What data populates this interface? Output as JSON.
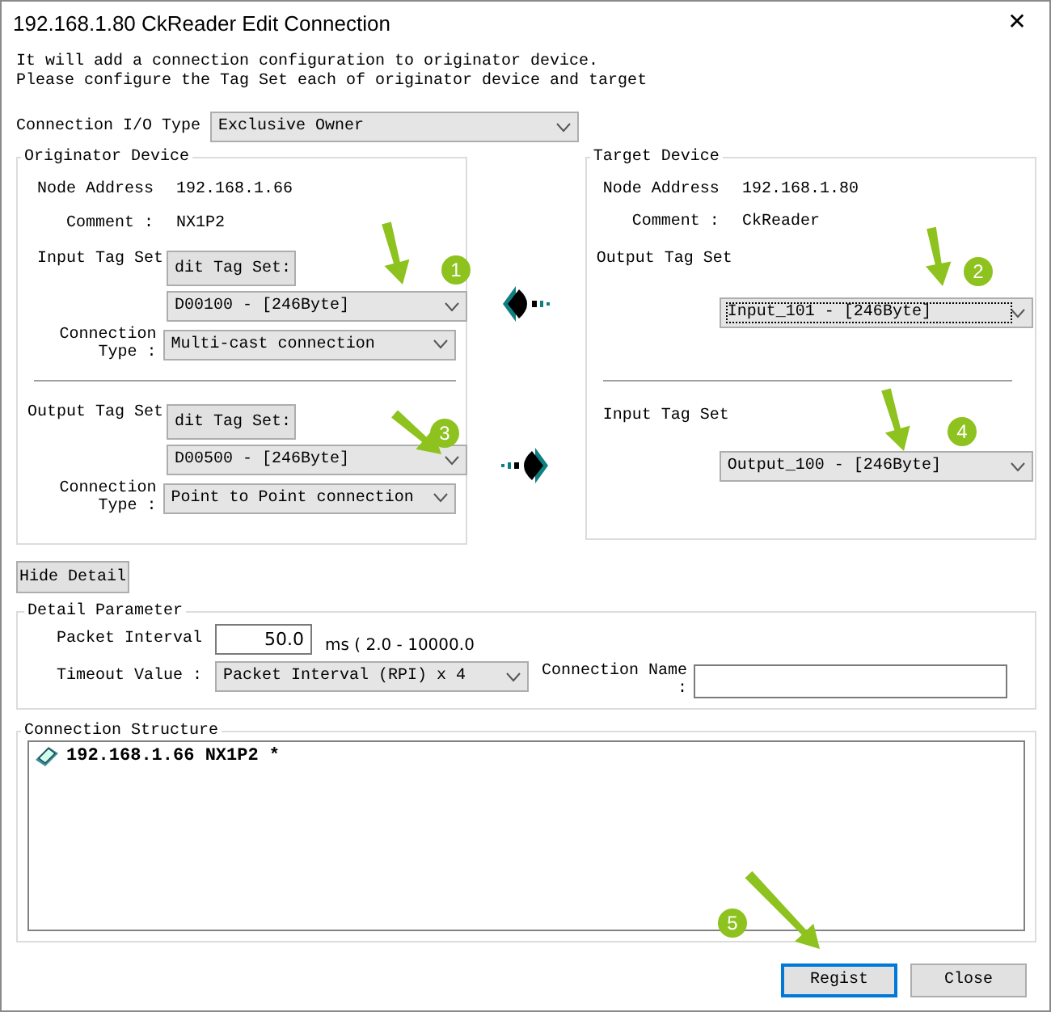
{
  "window": {
    "title": "192.168.1.80 CkReader Edit Connection",
    "close": "✕"
  },
  "intro": [
    "It will add a connection configuration to originator device.",
    "Please configure the Tag Set each of originator device and target"
  ],
  "io_type": {
    "label": "Connection I/O Type",
    "value": "Exclusive Owner"
  },
  "originator": {
    "title": "Originator Device",
    "node_label": "Node Address",
    "node": "192.168.1.66",
    "comment_label": "Comment :",
    "comment": "NX1P2",
    "sections": [
      {
        "label": "Input Tag Set",
        "button": "dit Tag Set:",
        "tag": "D00100 - [246Byte]",
        "type_label": "Connection Type :",
        "type": "Multi-cast connection"
      },
      {
        "label": "Output Tag Set",
        "button": "dit Tag Set:",
        "tag": "D00500 - [246Byte]",
        "type_label": "Connection Type :",
        "type": "Point to Point connection"
      }
    ]
  },
  "target": {
    "title": "Target Device",
    "node_label": "Node Address",
    "node": "192.168.1.80",
    "comment_label": "Comment :",
    "comment": "CkReader",
    "sections": [
      {
        "label": "Output Tag Set",
        "tag": "Input_101 - [246Byte]",
        "focused": true
      },
      {
        "label": "Input Tag Set",
        "tag": "Output_100 - [246Byte]",
        "focused": false
      }
    ]
  },
  "hide_detail": "Hide Detail",
  "detail": {
    "title": "Detail Parameter",
    "interval_label": "Packet Interval",
    "interval": "50.0",
    "range": "ms ( 2.0 - 10000.0",
    "timeout_label": "Timeout Value :",
    "timeout": "Packet Interval (RPI) x 4",
    "name_label": "Connection Name :"
  },
  "structure": {
    "title": "Connection Structure",
    "items": [
      "192.168.1.66 NX1P2 *"
    ]
  },
  "buttons": [
    {
      "label": "Regist",
      "kind": "default"
    },
    {
      "label": "Close",
      "kind": "normal"
    }
  ],
  "annotations": [
    {
      "number": "1"
    },
    {
      "number": "2"
    },
    {
      "number": "3"
    },
    {
      "number": "4"
    },
    {
      "number": "5"
    }
  ]
}
